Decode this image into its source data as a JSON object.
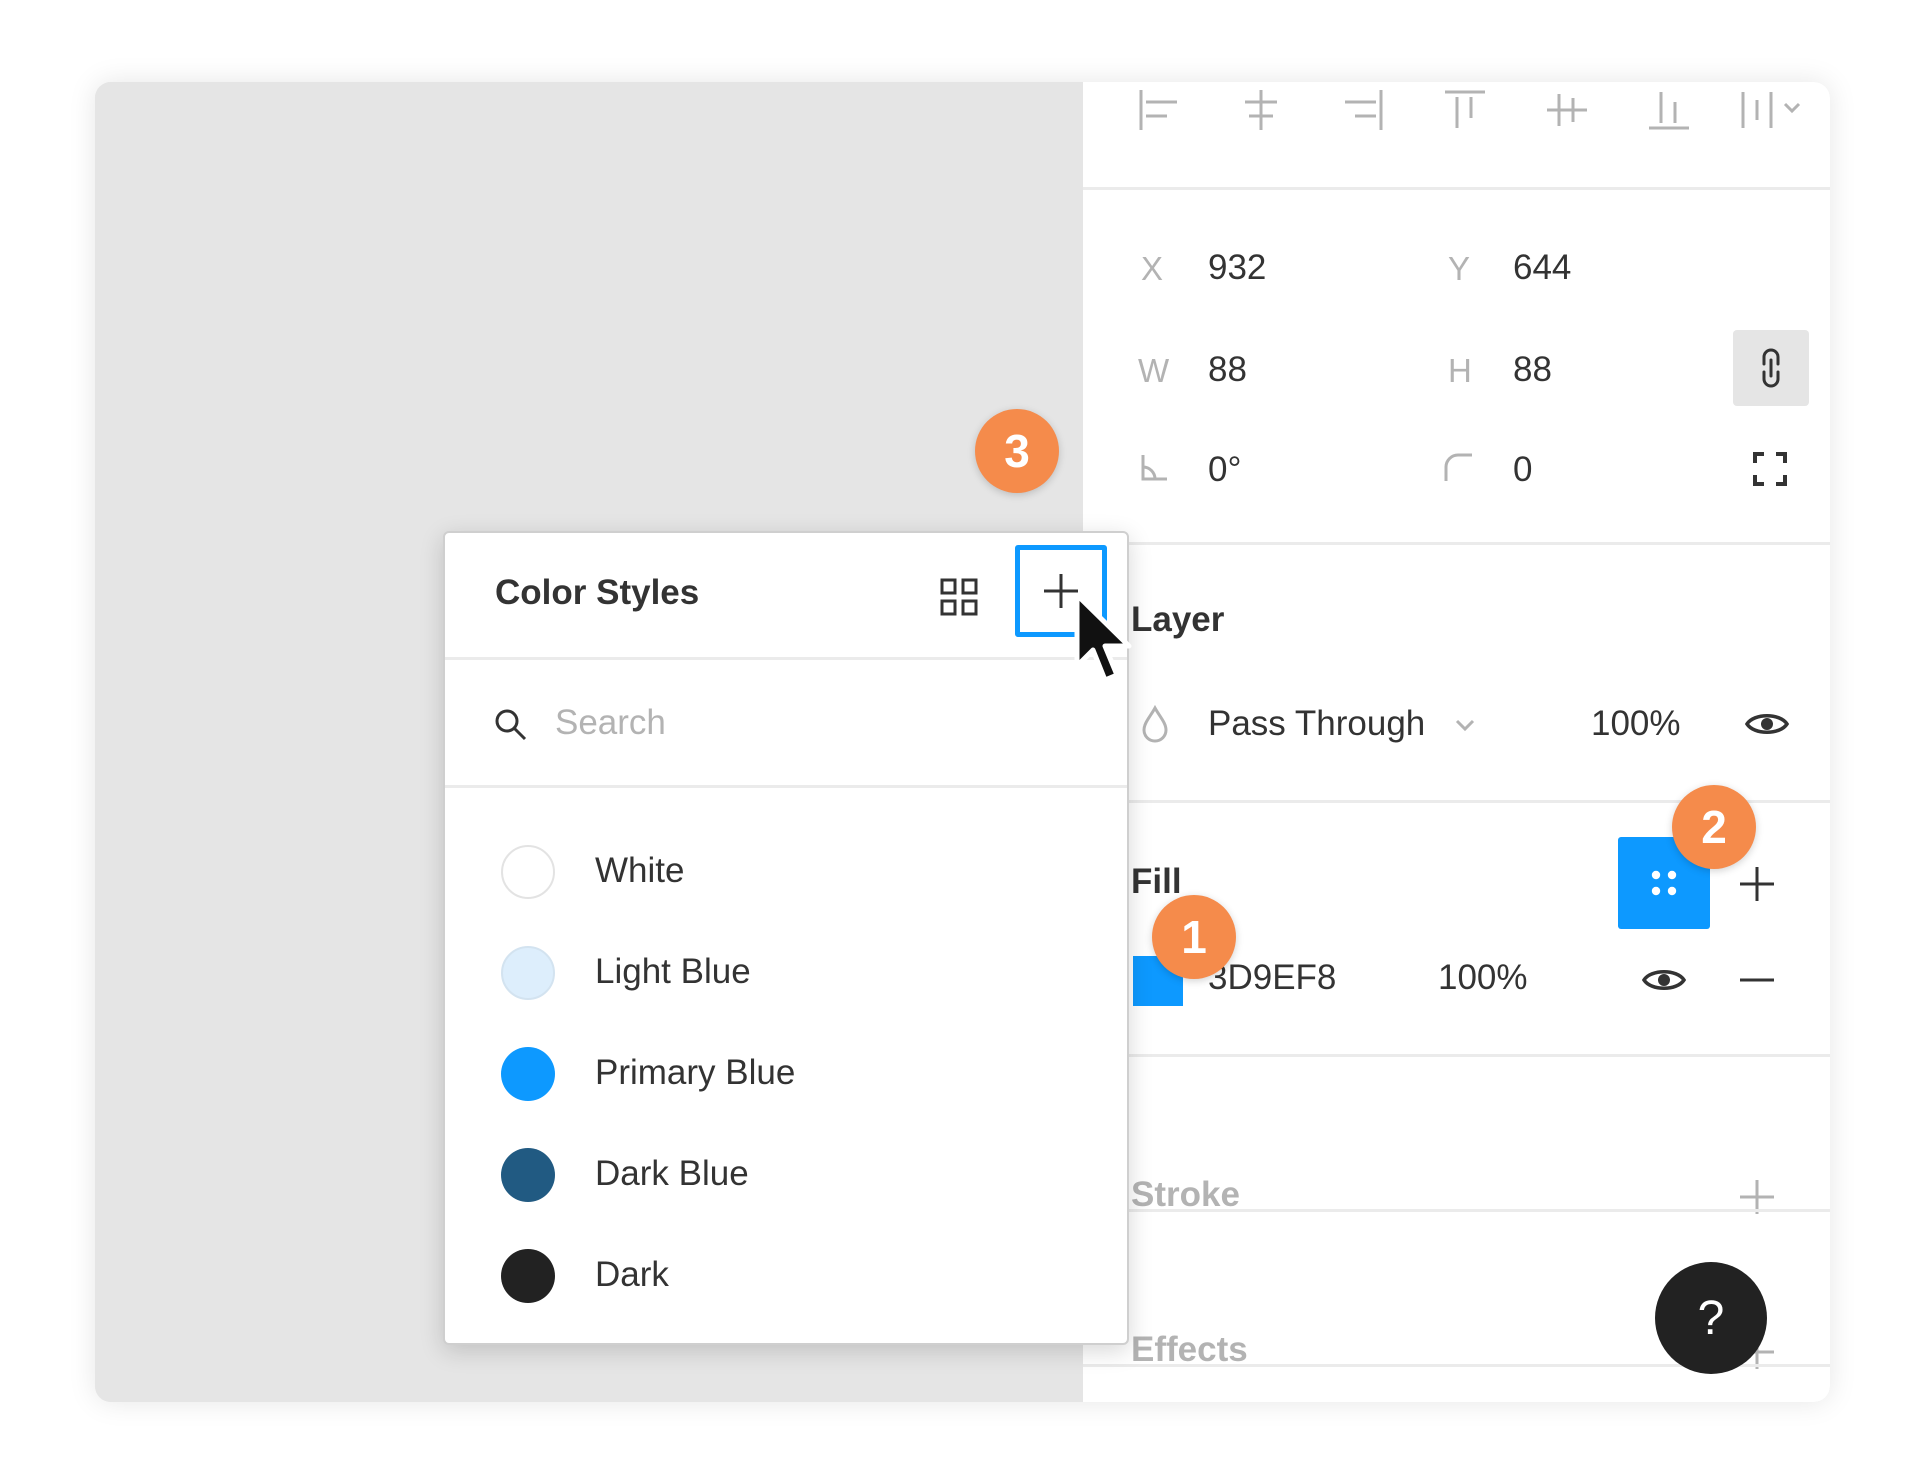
{
  "panel": {
    "align_icons": [
      "align-left-icon",
      "align-horizontal-center-icon",
      "align-right-icon",
      "align-top-icon",
      "align-vertical-center-icon",
      "align-bottom-icon",
      "distribute-icon"
    ],
    "position": {
      "x_label": "X",
      "x_value": "932",
      "y_label": "Y",
      "y_value": "644",
      "w_label": "W",
      "w_value": "88",
      "h_label": "H",
      "h_value": "88",
      "rotation_value": "0°",
      "radius_value": "0"
    },
    "layer": {
      "title": "Layer",
      "blend_mode": "Pass Through",
      "opacity": "100%"
    },
    "fill": {
      "title": "Fill",
      "color_hex": "3D9EF8",
      "opacity": "100%",
      "swatch_color": "#0d99ff"
    },
    "stroke": {
      "title": "Stroke"
    },
    "effects": {
      "title": "Effects"
    }
  },
  "color_styles": {
    "title": "Color Styles",
    "search_placeholder": "Search",
    "items": [
      {
        "name": "White",
        "color": "#ffffff"
      },
      {
        "name": "Light Blue",
        "color": "#ddeefc"
      },
      {
        "name": "Primary Blue",
        "color": "#0d99ff"
      },
      {
        "name": "Dark Blue",
        "color": "#215a82"
      },
      {
        "name": "Dark",
        "color": "#222222"
      }
    ]
  },
  "badges": [
    "1",
    "2",
    "3"
  ],
  "help": {
    "label": "?"
  },
  "colors": {
    "accent": "#0d99ff",
    "badge": "#f58b4b"
  }
}
